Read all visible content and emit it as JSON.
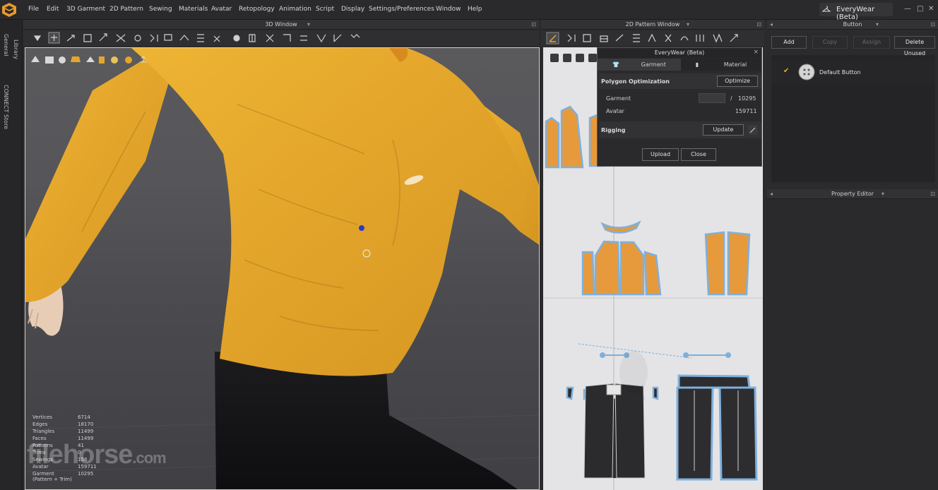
{
  "menubar": {
    "items": [
      "File",
      "Edit",
      "3D Garment",
      "2D Pattern",
      "Sewing",
      "Materials",
      "Avatar",
      "Retopology",
      "Animation",
      "Script",
      "Display",
      "Settings/Preferences",
      "Window",
      "Help"
    ],
    "app_title": "EveryWear (Beta)",
    "window_controls": [
      "—",
      "□",
      "✕"
    ]
  },
  "left_strip": {
    "tabs": [
      "Library",
      "General",
      "CONNECT Store"
    ]
  },
  "panels": {
    "window_3d": "3D Window",
    "window_2d": "2D Pattern Window",
    "button": "Button",
    "property_editor": "Property Editor"
  },
  "stats": [
    {
      "label": "Vertices",
      "value": "6714"
    },
    {
      "label": "Edges",
      "value": "18170"
    },
    {
      "label": "Triangles",
      "value": "11499"
    },
    {
      "label": "Faces",
      "value": "11499"
    },
    {
      "label": "Patterns",
      "value": "41"
    },
    {
      "label": "Trims",
      "value": "0"
    },
    {
      "label": "Sewings",
      "value": "158"
    },
    {
      "label": "Avatar",
      "value": "159711"
    },
    {
      "label": "Garment",
      "value": "10295"
    },
    {
      "label": "(Pattern + Trim)",
      "value": ""
    }
  ],
  "watermark": {
    "main": "filehorse",
    "suffix": ".com"
  },
  "everywear": {
    "title": "EveryWear (Beta)",
    "close": "×",
    "tabs": {
      "garment": "Garment",
      "material": "Material"
    },
    "polygon_optimization": "Polygon Optimization",
    "optimize_label": "Optimize",
    "garment_label": "Garment",
    "garment_separator": "/",
    "garment_total": "10295",
    "avatar_label": "Avatar",
    "avatar_value": "159711",
    "rigging_label": "Rigging",
    "update_label": "Update",
    "upload_label": "Upload",
    "close_label": "Close"
  },
  "button_panel": {
    "add": "Add",
    "copy": "Copy",
    "assign": "Assign",
    "delete_unused": "Delete Unused",
    "default_button": "Default Button"
  },
  "colors": {
    "garment": "#e6a52a",
    "pattern_piece": "#e69a3c",
    "pattern_outline": "#7fb0dc",
    "accent_check": "#e8b02c"
  }
}
